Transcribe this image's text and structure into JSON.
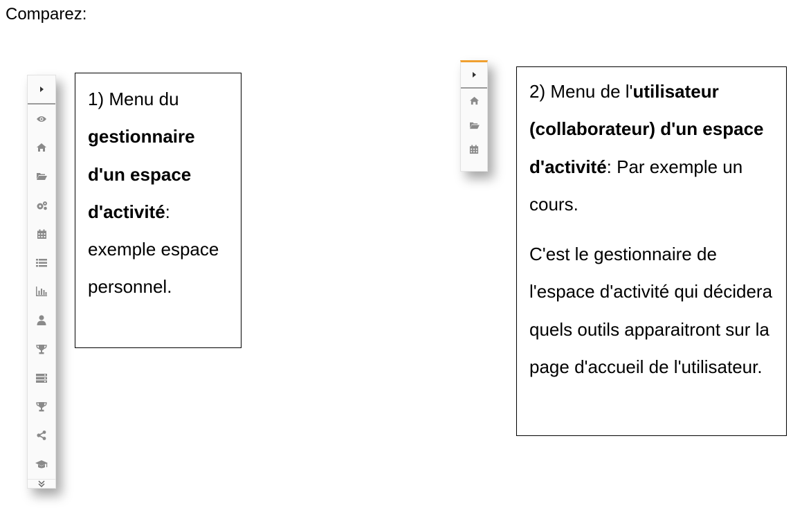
{
  "heading": "Comparez:",
  "menu_manager": {
    "items": [
      "eye-icon",
      "home-icon",
      "folder-open-icon",
      "cogs-icon",
      "calendar-icon",
      "list-icon",
      "bar-chart-icon",
      "user-icon",
      "trophy-icon",
      "server-icon",
      "trophy-icon",
      "share-icon",
      "graduation-cap-icon"
    ],
    "expand_icon": "caret-right-icon",
    "more_icon": "double-chevron-down-icon",
    "accent": "#9a9a9a"
  },
  "menu_user": {
    "items": [
      "home-icon",
      "folder-open-icon",
      "calendar-icon"
    ],
    "expand_icon": "caret-right-icon",
    "accent": "#f0a030"
  },
  "box1": {
    "prefix": "1) Menu du",
    "bold": "gestionnaire d'un espace d'activité",
    "suffix": ":",
    "rest": "exemple espace personnel."
  },
  "box2": {
    "prefix": "2) Menu de l'",
    "bold1": "utilisateur (collaborateur) d'un espace d'activité",
    "suffix": ": Par exemple un cours.",
    "para2": "C'est le gestionnaire de l'espace d'activité qui décidera quels outils apparaitront sur la page d'accueil de l'utilisateur."
  }
}
